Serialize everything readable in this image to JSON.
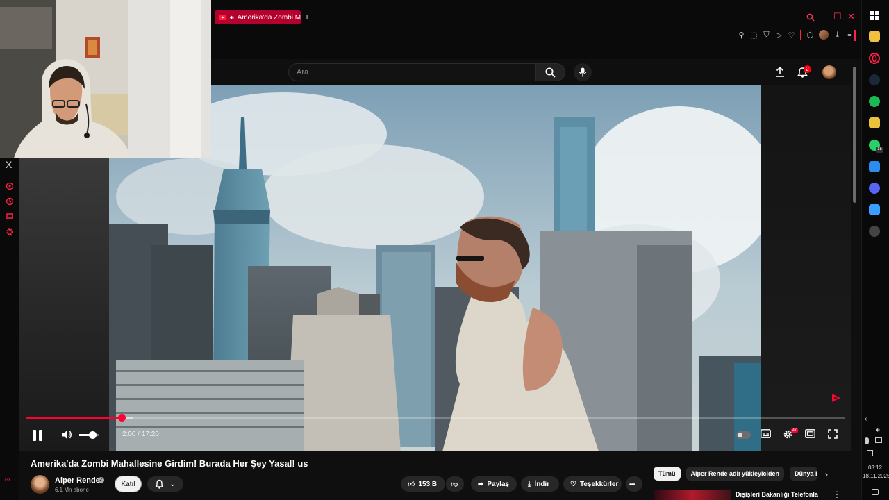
{
  "browser": {
    "tab_title": "Amerika'da Zombi Ma",
    "new_tab": "+",
    "minimize": "–",
    "maximize": "☐",
    "close": "✕"
  },
  "header": {
    "search_placeholder": "Ara",
    "notification_count": "2"
  },
  "player": {
    "current_time": "2:00",
    "time_separator": " / ",
    "duration": "17:20",
    "progress": 0.117,
    "volume": 0.68,
    "hd_badge": "4K"
  },
  "sidebar": {
    "close": "X",
    "brand": "GX"
  },
  "video": {
    "title": "Amerika'da Zombi Mahallesine Girdim! Burada Her Şey Yasal! us",
    "channel_name": "Alper Rende",
    "subscribers": "6,1 Mn abone",
    "join_label": "Katıl",
    "like_count": "153 B",
    "share_label": "Paylaş",
    "download_label": "İndir",
    "thanks_label": "Teşekkürler",
    "more": "•••"
  },
  "recommendations": {
    "chips": [
      "Tümü",
      "Alper Rende adlı yükleyiciden",
      "Dünya H"
    ],
    "next": "›",
    "first_title": "Dışişleri Bakanlığı Telefonla",
    "first_more": "⋮"
  },
  "taskbar": {
    "whatsapp_badge": "15",
    "time": "03:12",
    "date": "18.11.2025"
  },
  "colors": {
    "accent": "#ff0033",
    "opera_red": "#ff2244",
    "background": "#0f0f0f"
  }
}
